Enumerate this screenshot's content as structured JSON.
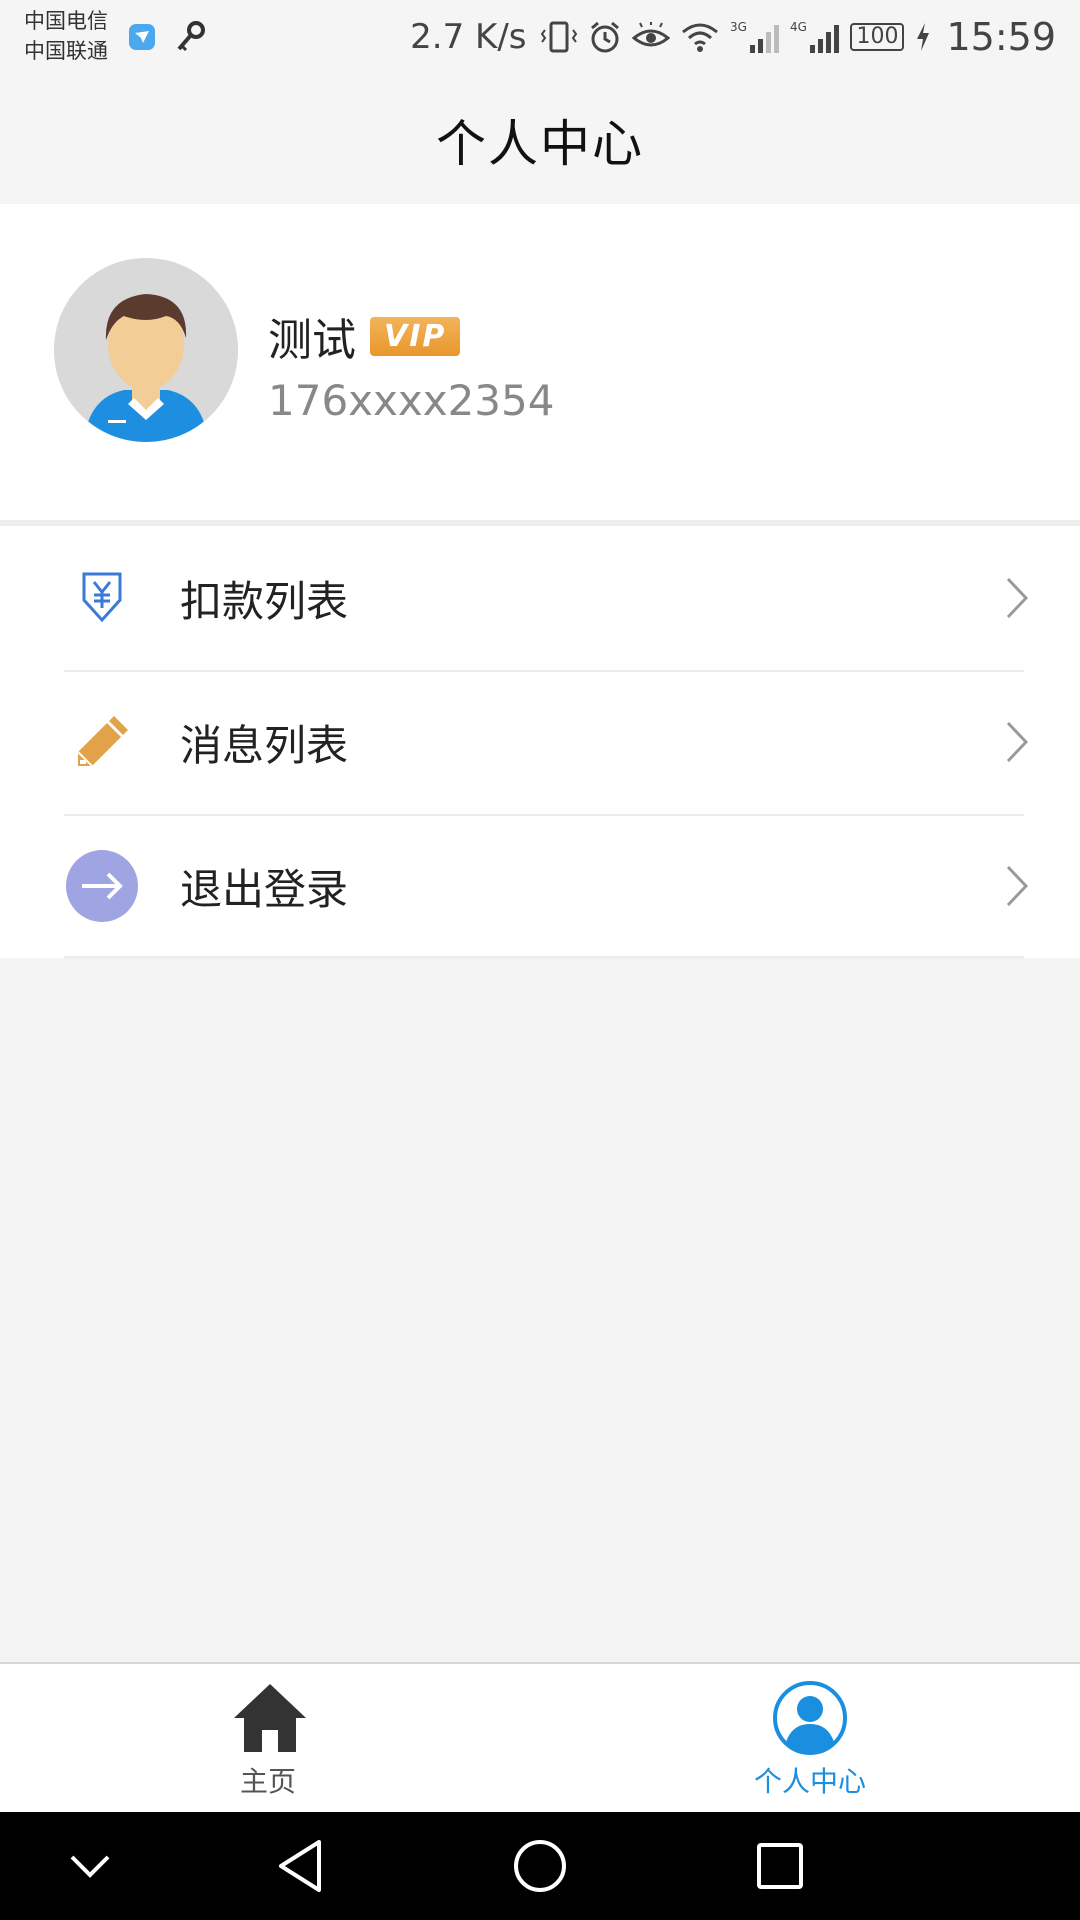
{
  "status_bar": {
    "carrier_1": "中国电信",
    "carrier_2": "中国联通",
    "speed": "2.7 K/s",
    "signal_3g": "3G",
    "signal_4g": "4G",
    "battery": "100",
    "time": "15:59"
  },
  "nav": {
    "title": "个人中心"
  },
  "profile": {
    "name": "测试",
    "badge": "VIP",
    "phone": "176xxxx2354"
  },
  "menu": [
    {
      "label": "扣款列表",
      "icon": "yuan-download-icon"
    },
    {
      "label": "消息列表",
      "icon": "pencil-icon"
    },
    {
      "label": "退出登录",
      "icon": "logout-arrow-icon"
    }
  ],
  "tabs": {
    "home": {
      "label": "主页",
      "icon": "home-icon"
    },
    "profile": {
      "label": "个人中心",
      "icon": "user-circle-icon",
      "active": true
    }
  },
  "colors": {
    "accent": "#1a8fe0",
    "vip": "#e9962c",
    "logout_icon_bg": "#9fa4e3",
    "pencil": "#e2a24a",
    "deduct_icon": "#3a7bd5"
  }
}
